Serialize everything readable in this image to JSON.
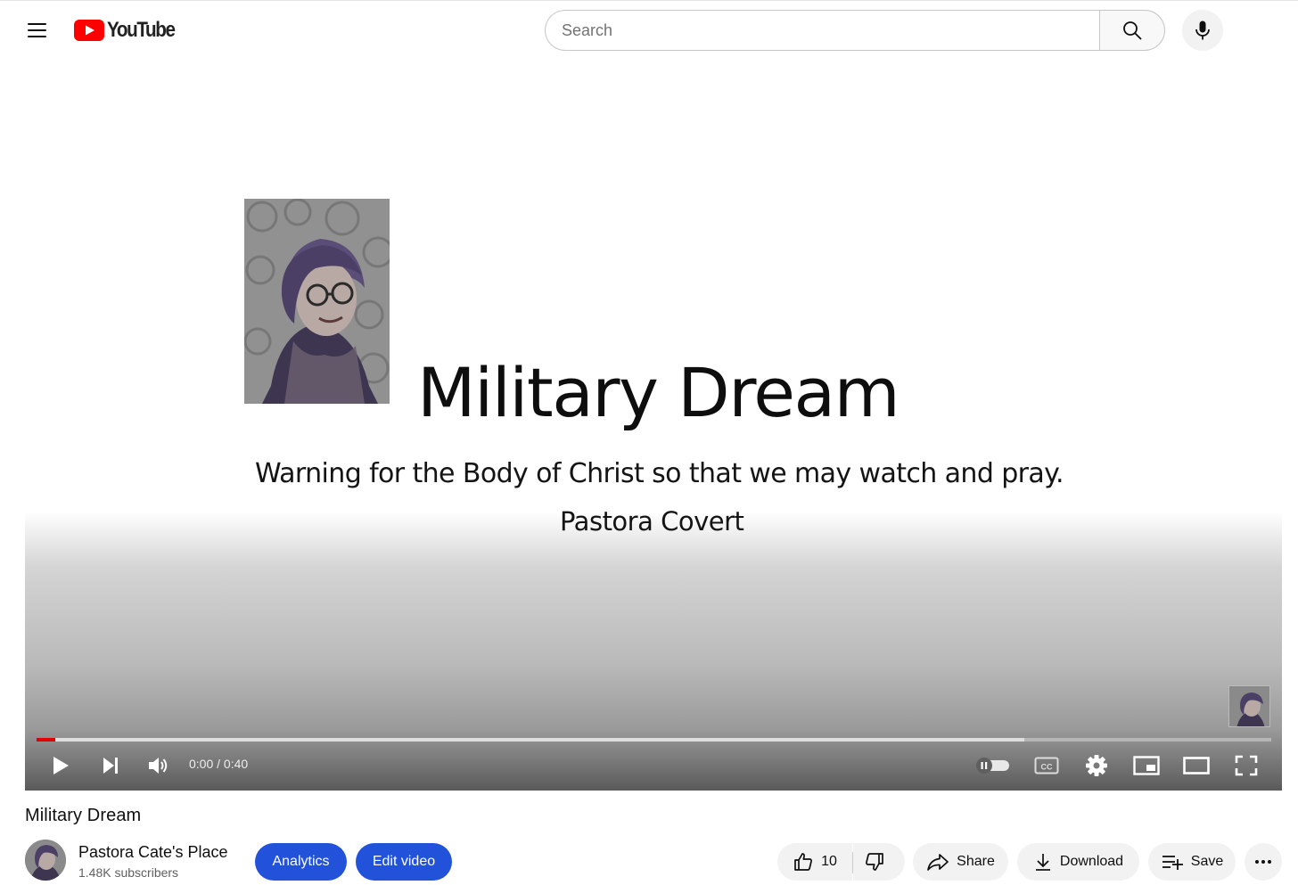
{
  "masthead": {
    "menu_icon": "hamburger-menu-icon",
    "logo_text": "YouTube",
    "brand_color": "#ff0000",
    "search": {
      "placeholder": "Search",
      "value": ""
    },
    "search_icon": "search-icon",
    "mic_icon": "microphone-icon"
  },
  "player": {
    "slide": {
      "title": "Military Dream",
      "subtitle": "Warning for the Body of Christ so that we may watch and pray.",
      "author": "Pastora Covert"
    },
    "progress": {
      "played_fraction": 0.015,
      "buffered_fraction": 0.8,
      "played_color": "#e00000"
    },
    "time": {
      "current": "0:00",
      "separator": " / ",
      "duration": "0:40"
    },
    "controls": {
      "left": [
        "play-icon",
        "next-icon",
        "volume-icon"
      ],
      "right": [
        "autoplay-toggle-icon",
        "captions-icon",
        "settings-gear-icon",
        "miniplayer-icon",
        "theater-mode-icon",
        "fullscreen-icon"
      ]
    }
  },
  "video": {
    "title": "Military Dream",
    "channel": {
      "name": "Pastora Cate's Place",
      "subscribers": "1.48K subscribers"
    },
    "buttons": {
      "analytics": "Analytics",
      "edit_video": "Edit video",
      "like_count": "10",
      "share": "Share",
      "download": "Download",
      "save": "Save"
    },
    "accent_color": "#2152d9"
  }
}
